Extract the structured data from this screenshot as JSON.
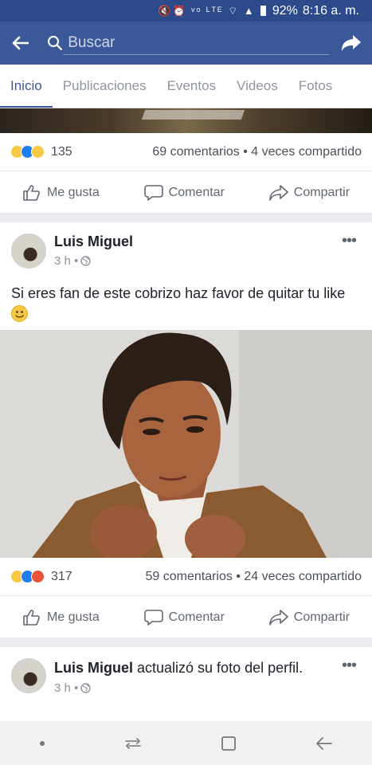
{
  "status_bar": {
    "icons": "🔇⏰ ᵛᵒ ᴸᵀᴱ ⌔ ▲",
    "battery": "92%",
    "time": "8:16 a. m."
  },
  "search": {
    "value": "",
    "placeholder": "Buscar"
  },
  "tabs": [
    {
      "label": "Inicio",
      "active": true
    },
    {
      "label": "Publicaciones"
    },
    {
      "label": "Eventos"
    },
    {
      "label": "Videos"
    },
    {
      "label": "Fotos"
    }
  ],
  "post_prev": {
    "reaction_count": "135",
    "counts": "69 comentarios • 4 veces compartido",
    "reactions": [
      "haha",
      "like",
      "wow"
    ]
  },
  "actions": {
    "like": "Me gusta",
    "comment": "Comentar",
    "share": "Compartir"
  },
  "post1": {
    "author": "Luis Miguel",
    "time": "3 h •",
    "text": "Si eres fan de este cobrizo haz favor de quitar tu like",
    "reaction_count": "317",
    "counts": "59 comentarios • 24 veces compartido",
    "reactions": [
      "haha",
      "like",
      "angry"
    ]
  },
  "post2": {
    "author": "Luis Miguel",
    "action_text": " actualizó su foto del perfil.",
    "time": "3 h •"
  },
  "colors": {
    "brand": "#3b5998",
    "status_bar": "#2d4b8a",
    "like_blue": "#1f7df2"
  }
}
